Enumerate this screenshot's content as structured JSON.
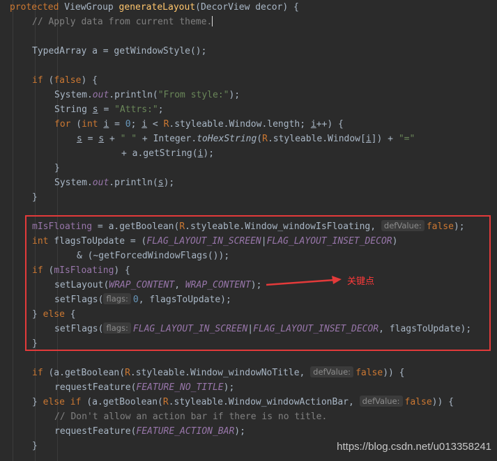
{
  "code": {
    "l01": [
      "protected",
      " ViewGroup ",
      "generateLayout",
      "(DecorView decor) {"
    ],
    "l02": "// Apply data from current theme.",
    "l03": "TypedArray a = getWindowStyle();",
    "l04a": "if",
    "l04b": " (",
    "l04c": "false",
    "l04d": ") {",
    "l05a": "System.",
    "l05b": "out",
    "l05c": ".println(",
    "l05d": "\"From style:\"",
    "l05e": ");",
    "l06a": "String ",
    "l06b": "s",
    "l06c": " = ",
    "l06d": "\"Attrs:\"",
    "l06e": ";",
    "l07a": "for",
    "l07b": " (",
    "l07c": "int",
    "l07d": " ",
    "l07e": "i",
    "l07f": " = ",
    "l07g": "0",
    "l07h": "; ",
    "l07i": "i",
    "l07j": " < ",
    "l07k": "R",
    "l07l": ".styleable.Window.length; ",
    "l07m": "i",
    "l07n": "++) {",
    "l08a": "s",
    "l08b": " = ",
    "l08c": "s",
    "l08d": " + ",
    "l08e": "\" \"",
    "l08f": " + Integer.",
    "l08g": "toHexString",
    "l08h": "(",
    "l08i": "R",
    "l08j": ".styleable.Window[",
    "l08k": "i",
    "l08l": "]) + ",
    "l08m": "\"=\"",
    "l09a": "+ a.getString(",
    "l09b": "i",
    "l09c": ");",
    "l10": "}",
    "l11a": "System.",
    "l11b": "out",
    "l11c": ".println(",
    "l11d": "s",
    "l11e": ");",
    "l12": "}",
    "l13a": "mIsFloating",
    "l13b": " = a.getBoolean(",
    "l13c": "R",
    "l13d": ".styleable.Window_windowIsFloating, ",
    "l13h": "defValue:",
    "l13e": "false",
    "l13f": ");",
    "l14a": "int",
    "l14b": " flagsToUpdate = (",
    "l14c": "FLAG_LAYOUT_IN_SCREEN",
    "l14d": "|",
    "l14e": "FLAG_LAYOUT_INSET_DECOR",
    "l14f": ")",
    "l15": "& (~getForcedWindowFlags());",
    "l16a": "if",
    "l16b": " (",
    "l16c": "mIsFloating",
    "l16d": ") {",
    "l17a": "setLayout(",
    "l17b": "WRAP_CONTENT",
    "l17c": ", ",
    "l17d": "WRAP_CONTENT",
    "l17e": ");",
    "l18a": "setFlags(",
    "l18h": "flags:",
    "l18b": "0",
    "l18c": ", flagsToUpdate);",
    "l19a": "} ",
    "l19b": "else",
    "l19c": " {",
    "l20a": "setFlags(",
    "l20h": "flags:",
    "l20b": "FLAG_LAYOUT_IN_SCREEN",
    "l20c": "|",
    "l20d": "FLAG_LAYOUT_INSET_DECOR",
    "l20e": ", flagsToUpdate);",
    "l21": "}",
    "l22a": "if",
    "l22b": " (a.getBoolean(",
    "l22c": "R",
    "l22d": ".styleable.Window_windowNoTitle, ",
    "l22h": "defValue:",
    "l22e": "false",
    "l22f": ")) {",
    "l23a": "requestFeature(",
    "l23b": "FEATURE_NO_TITLE",
    "l23c": ");",
    "l24a": "} ",
    "l24b": "else if",
    "l24c": " (a.getBoolean(",
    "l24d": "R",
    "l24e": ".styleable.Window_windowActionBar, ",
    "l24h": "defValue:",
    "l24f": "false",
    "l24g": ")) {",
    "l25": "// Don't allow an action bar if there is no title.",
    "l26a": "requestFeature(",
    "l26b": "FEATURE_ACTION_BAR",
    "l26c": ");",
    "l27": "}"
  },
  "annotation": "关键点",
  "watermark": "https://blog.csdn.net/u013358241",
  "colors": {
    "box": "#e33a3a",
    "arrow": "#e33a3a"
  }
}
